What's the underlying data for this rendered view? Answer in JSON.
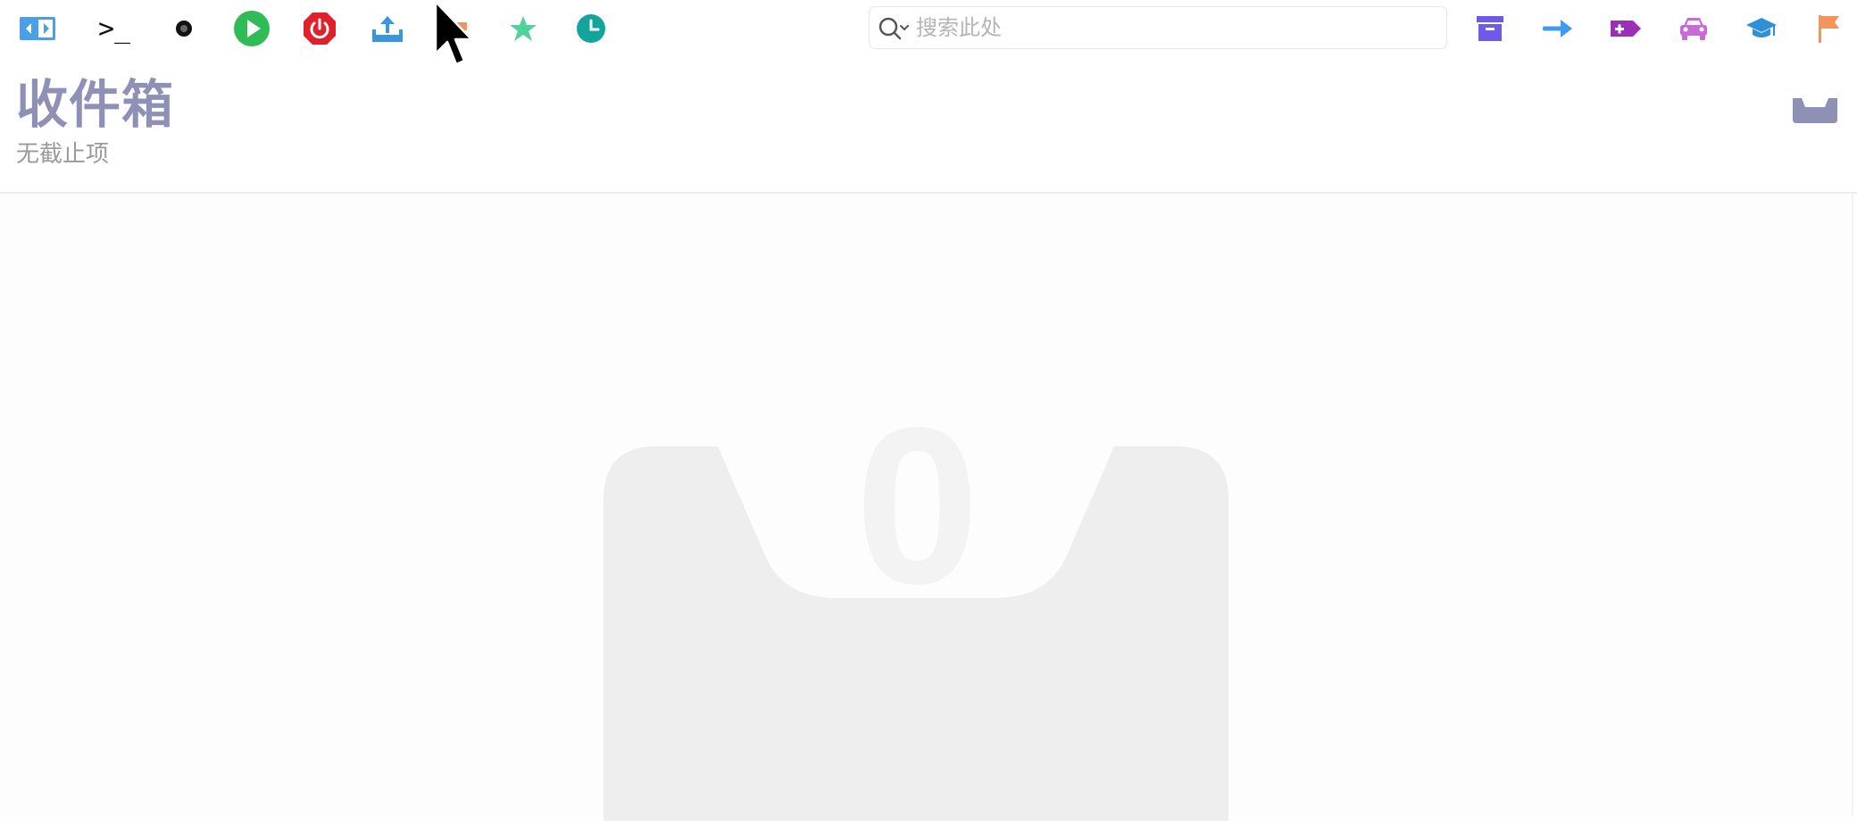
{
  "toolbar": {
    "left_icons": [
      "sidebar-toggle-icon",
      "terminal-icon",
      "record-icon",
      "play-icon",
      "power-icon",
      "share-icon",
      "flag-badge-icon",
      "star-icon",
      "clock-icon"
    ],
    "terminal_glyph": ">_",
    "right_icons": [
      "archive-icon",
      "forward-arrow-icon",
      "add-tag-icon",
      "car-icon",
      "graduation-cap-icon",
      "flag-icon"
    ]
  },
  "search": {
    "placeholder": "搜索此处",
    "value": ""
  },
  "header": {
    "title": "收件箱",
    "subtitle": "无截止项"
  },
  "empty_state": {
    "count": "0"
  },
  "colors": {
    "title": "#8e91b5",
    "subtitle": "#9a9a9a",
    "tray": "#8e91b5",
    "archive": "#6d5ae6",
    "forward": "#3d9bf0",
    "tag": "#9b2fb5",
    "car": "#c86ad8",
    "cap": "#2f8fd8",
    "flag": "#f4945a",
    "play": "#2fbb55",
    "power": "#e0212b",
    "star": "#4fd39a",
    "clock": "#14a49e",
    "share": "#3a96e0",
    "empty_art": "#eeeeee"
  }
}
